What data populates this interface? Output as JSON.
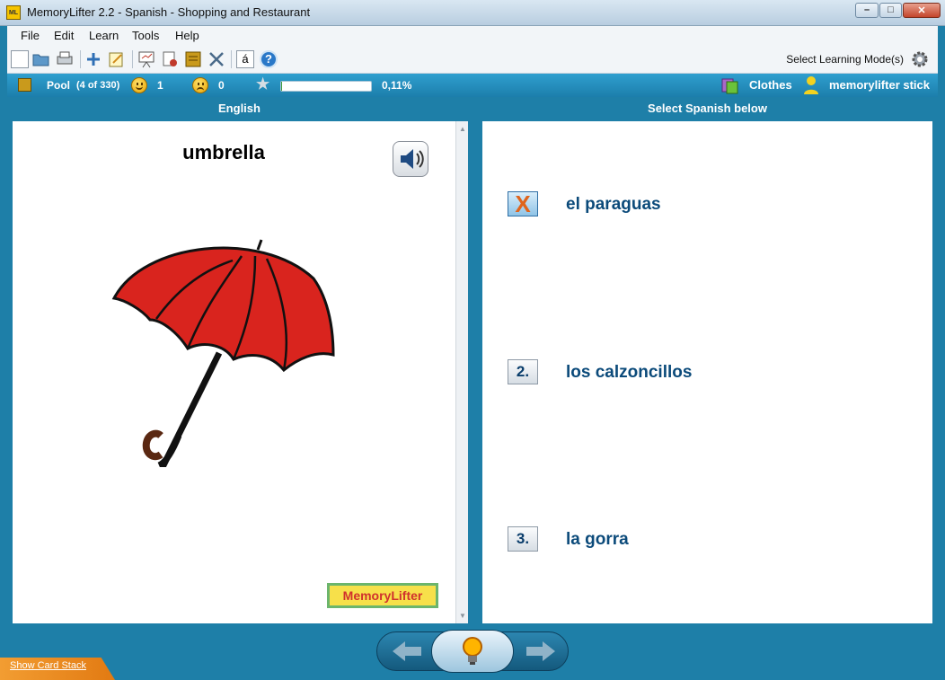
{
  "window": {
    "app_icon_text": "ML",
    "title": "MemoryLifter 2.2 - Spanish - Shopping and Restaurant",
    "minimize_glyph": "–",
    "maximize_glyph": "□",
    "close_glyph": "✕"
  },
  "menu": {
    "items": [
      "File",
      "Edit",
      "Learn",
      "Tools",
      "Help"
    ]
  },
  "toolbar": {
    "icons": [
      "new-file-icon",
      "open-folder-icon",
      "print-icon",
      "add-card-icon",
      "edit-card-icon",
      "presentation-icon",
      "card-stack-icon",
      "chapter-icon",
      "settings-tools-icon",
      "special-char-icon",
      "help-icon"
    ],
    "special_char_glyph": "á",
    "help_glyph": "?",
    "learn_mode_label": "Select Learning Mode(s)"
  },
  "status": {
    "pool_label": "Pool",
    "pool_count": "(4 of 330)",
    "correct_count": "1",
    "wrong_count": "0",
    "progress_percent": "0,11%",
    "progress_fraction": 0.0011,
    "chapter": "Clothes",
    "user": "memorylifter stick"
  },
  "question": {
    "header": "English",
    "word": "umbrella"
  },
  "answers": {
    "header": "Select Spanish below",
    "items": [
      {
        "marker": "X",
        "text": "el paraguas"
      },
      {
        "marker": "2.",
        "text": "los calzoncillos"
      },
      {
        "marker": "3.",
        "text": "la gorra"
      }
    ]
  },
  "logo_text": "MemoryLifter",
  "bottom": {
    "show_card_stack": "Show Card Stack"
  },
  "colors": {
    "accent": "#1e7fa8",
    "answer_text": "#0b4a7a",
    "umbrella_red": "#d9241e",
    "wrong_marker": "#e0641b"
  }
}
